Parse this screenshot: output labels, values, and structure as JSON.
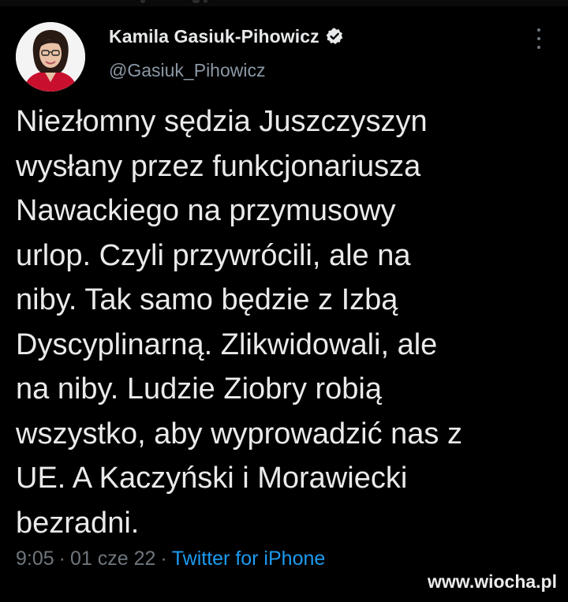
{
  "author": {
    "display_name": "Kamila Gasiuk-Pihowicz",
    "handle": "@Gasiuk_Pihowicz",
    "verified": true
  },
  "tweet": {
    "text": "Niezłomny sędzia Juszczyszyn\nwysłany przez funkcjonariusza\nNawackiego na przymusowy\nurlop. Czyli przywrócili, ale na\nniby. Tak samo będzie z Izbą\nDyscyplinarną. Zlikwidowali, ale\nna niby. Ludzie Ziobry robią\nwszystko, aby wyprowadzić nas z\nUE. A Kaczyński i Morawiecki\nbezradni.",
    "time": "9:05",
    "date": "01 cze 22",
    "separator": "·",
    "source": "Twitter for iPhone"
  },
  "watermark": "www.wiocha.pl",
  "icons": {
    "verified": "verified-badge-icon",
    "more": "more-options-icon"
  },
  "colors": {
    "background": "#000000",
    "text": "#e7e9ea",
    "secondary": "#8b98a5",
    "link": "#1d9bf0"
  }
}
